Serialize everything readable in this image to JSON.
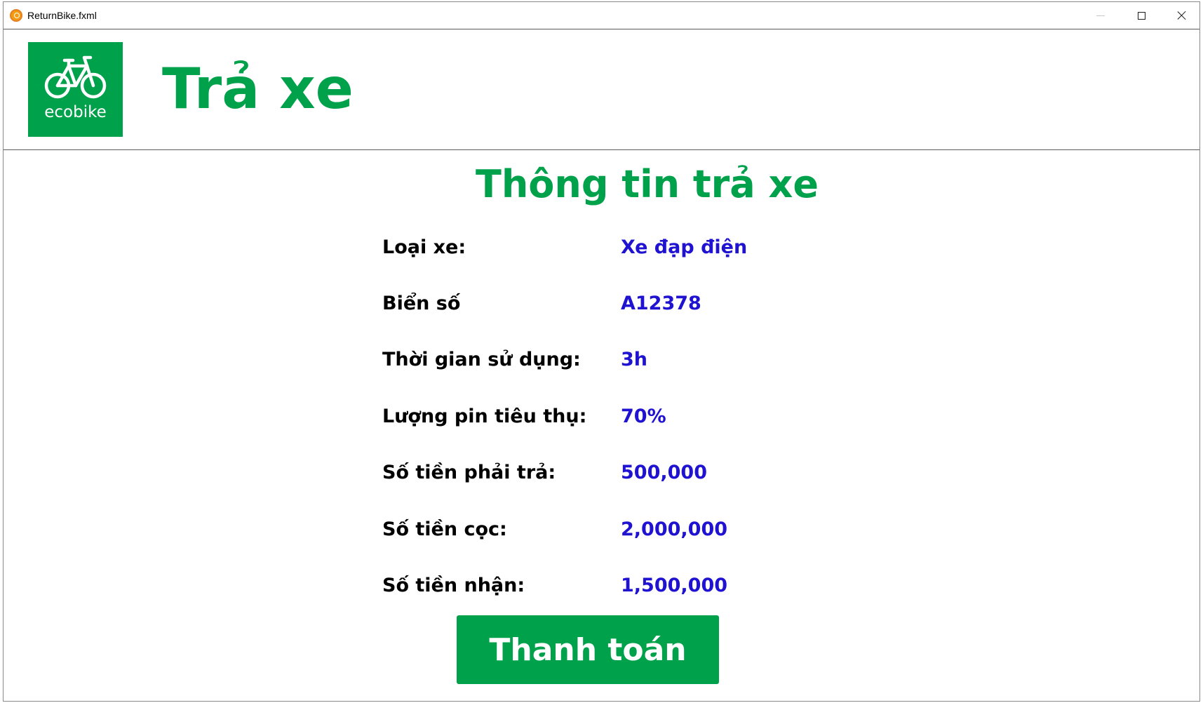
{
  "window": {
    "title": "ReturnBike.fxml"
  },
  "header": {
    "logo_text": "ecobike",
    "title": "Trả xe"
  },
  "main": {
    "section_title": "Thông tin trả xe",
    "rows": [
      {
        "label": "Loại xe:",
        "value": "Xe đạp điện"
      },
      {
        "label": "Biển số",
        "value": "A12378"
      },
      {
        "label": "Thời gian sử dụng:",
        "value": "3h"
      },
      {
        "label": "Lượng pin tiêu thụ:",
        "value": "70%"
      },
      {
        "label": "Số tiền phải trả:",
        "value": "500,000"
      },
      {
        "label": "Số tiền cọc:",
        "value": "2,000,000"
      },
      {
        "label": "Số tiền nhận:",
        "value": "1,500,000"
      }
    ],
    "pay_button_label": "Thanh toán"
  },
  "colors": {
    "brand_green": "#00a14b",
    "value_blue": "#1f13d1"
  }
}
